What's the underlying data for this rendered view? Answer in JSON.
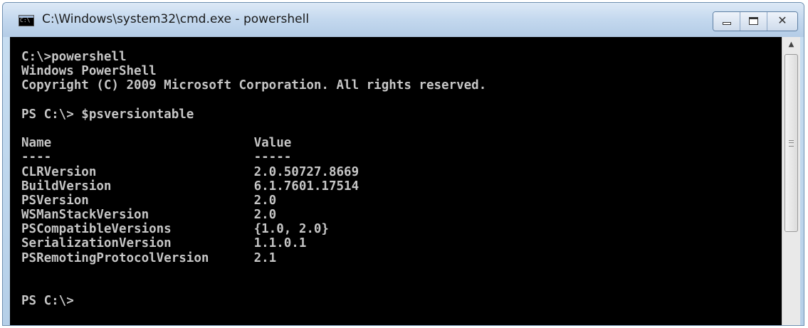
{
  "window": {
    "title": "C:\\Windows\\system32\\cmd.exe - powershell",
    "icon_label": "C:\\",
    "icon": "cmd-app-icon",
    "close_glyph": "✕"
  },
  "console": {
    "lines": [
      "C:\\>powershell",
      "Windows PowerShell",
      "Copyright (C) 2009 Microsoft Corporation. All rights reserved.",
      "",
      "PS C:\\> $psversiontable",
      "",
      "Name                           Value",
      "----                           -----",
      "CLRVersion                     2.0.50727.8669",
      "BuildVersion                   6.1.7601.17514",
      "PSVersion                      2.0",
      "WSManStackVersion              2.0",
      "PSCompatibleVersions           {1.0, 2.0}",
      "SerializationVersion           1.1.0.1",
      "PSRemotingProtocolVersion      2.1",
      "",
      "",
      "PS C:\\>"
    ]
  },
  "scrollbar": {
    "up_arrow": "▲"
  },
  "colors": {
    "console_background": "#000000",
    "console_text": "#c6c6c6",
    "titlebar": "#c3d8ee"
  }
}
